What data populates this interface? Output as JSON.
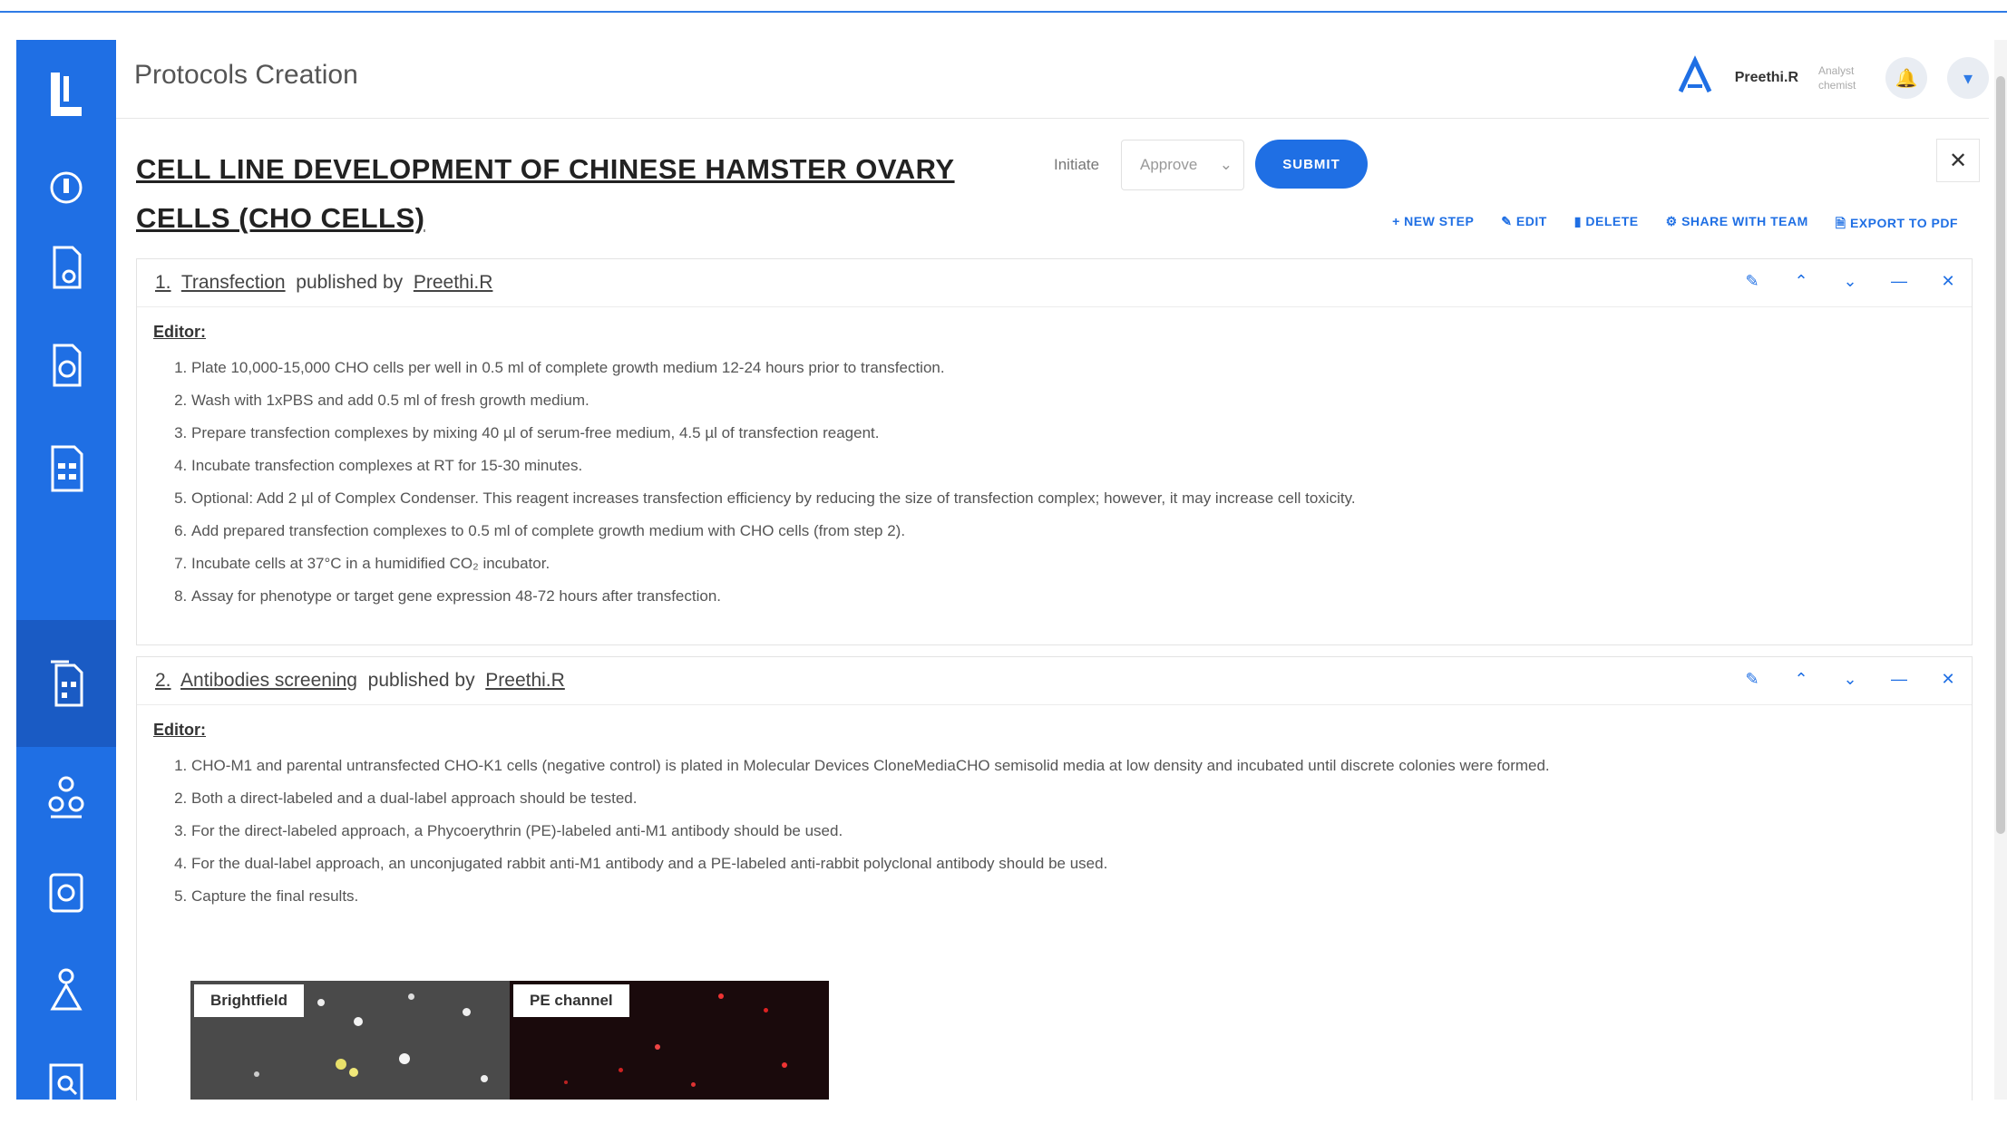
{
  "header": {
    "page_title": "Protocols Creation",
    "user_name": "Preethi.R",
    "user_role": "Analyst chemist"
  },
  "protocol": {
    "title": "CELL LINE DEVELOPMENT OF CHINESE HAMSTER OVARY CELLS (CHO CELLS)",
    "initiate_label": "Initiate",
    "initiate_value": "Approve",
    "submit_label": "SUBMIT"
  },
  "toolbar": {
    "new_step": "+ NEW STEP",
    "edit": "EDIT",
    "delete": "DELETE",
    "share": "SHARE WITH TEAM",
    "export": "EXPORT TO PDF"
  },
  "steps": [
    {
      "number": "1.",
      "name": "Transfection",
      "published_by_label": "published by",
      "author": "Preethi.R",
      "editor_label": "Editor:",
      "lines": [
        "Plate 10,000-15,000 CHO cells per well in 0.5 ml of complete growth medium 12-24 hours prior to transfection.",
        "Wash with 1xPBS and add 0.5 ml of fresh growth medium.",
        "Prepare transfection complexes by mixing 40 µl of serum-free medium, 4.5 µl of transfection reagent.",
        "Incubate transfection complexes at RT for 15-30 minutes.",
        "Optional: Add 2 µl of Complex Condenser. This reagent increases transfection efficiency by reducing the size of transfection complex; however, it may increase cell toxicity.",
        "Add prepared transfection complexes to 0.5 ml of complete growth medium with CHO cells (from step 2).",
        "Incubate cells at 37°C in a humidified CO₂ incubator.",
        "Assay for phenotype or target gene expression 48-72 hours after transfection."
      ]
    },
    {
      "number": "2.",
      "name": "Antibodies screening",
      "published_by_label": "published by",
      "author": "Preethi.R",
      "editor_label": "Editor:",
      "lines": [
        "CHO-M1 and parental untransfected CHO-K1 cells (negative control) is plated in Molecular Devices CloneMediaCHO semisolid media at low density and incubated until discrete colonies were formed.",
        "Both a direct-labeled and a dual-label approach should be tested.",
        "For the direct-labeled approach, a Phycoerythrin (PE)-labeled anti-M1 antibody should be used.",
        "For the dual-label approach, an unconjugated rabbit anti-M1 antibody and a PE-labeled anti-rabbit polyclonal antibody should be used.",
        "Capture the final results."
      ],
      "image_labels": [
        "Brightfield",
        "PE channel"
      ]
    }
  ],
  "icons": {
    "sidebar": [
      "logo-icon",
      "dashboard-icon",
      "document-icon",
      "document-gear-icon",
      "document-list-icon",
      "protocol-icon",
      "flask-icon",
      "lab-icon",
      "team-icon",
      "search-document-icon"
    ],
    "accent": "#1f6fe4"
  }
}
